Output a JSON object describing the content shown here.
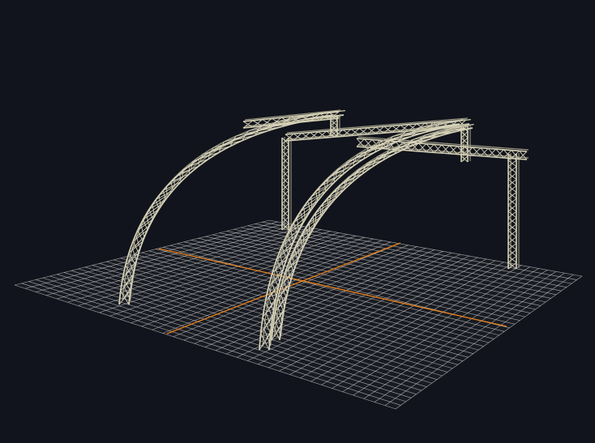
{
  "viewport": {
    "background": "#11141c",
    "grid_color": "#d8d8d8",
    "axis_color": "#e8821c",
    "truss_color": "#d6d2b8",
    "truss_shade": "#9c9884"
  },
  "scene": {
    "grid_divisions": 36,
    "arch_count": 3,
    "goalpost_count": 2
  }
}
